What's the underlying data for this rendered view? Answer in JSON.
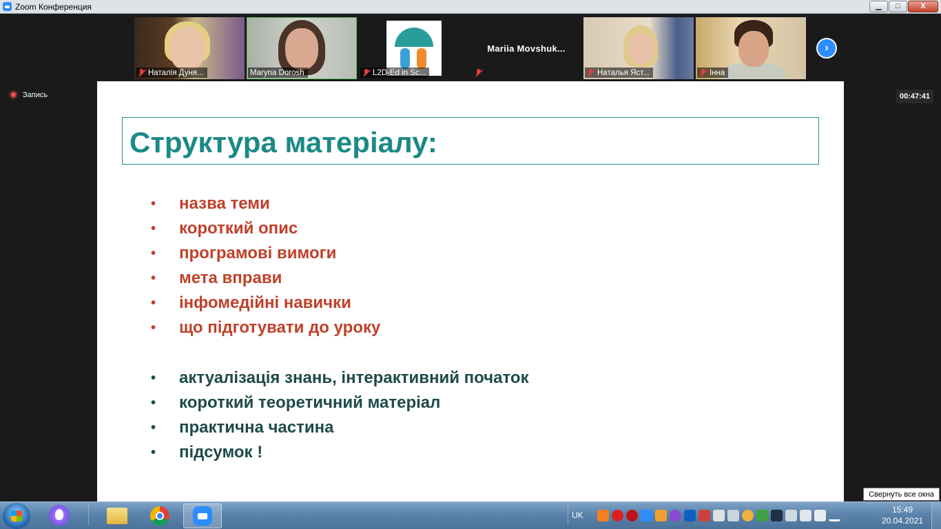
{
  "window": {
    "title": "Zoom Конференция",
    "minimize": "▁",
    "maximize": "□",
    "close": "X"
  },
  "participants": [
    {
      "name": "Наталія Дуня..."
    },
    {
      "name": "Maryna Dorosh"
    },
    {
      "name": "L2D-Ed in Sc..."
    },
    {
      "name": "Mariia  Movshuk..."
    },
    {
      "name": "Наталья Яст..."
    },
    {
      "name": "Інна"
    }
  ],
  "recording": {
    "label": "Запись"
  },
  "timer": "00:47:41",
  "slide": {
    "title": "Структура матеріалу:",
    "items_red": [
      "назва теми",
      "короткий опис",
      "програмові вимоги",
      "мета вправи",
      "інфомедійні навички",
      "що підготувати до уроку"
    ],
    "items_dark": [
      "актуалізація знань, інтерактивний початок",
      "короткий теоретичний матеріал",
      "практична частина",
      "підсумок !"
    ],
    "bullet": "•",
    "colors": {
      "title": "#1a8a86",
      "red_items": "#c0402a",
      "dark_items": "#1e4a4a"
    }
  },
  "tooltip": "Свернуть все окна",
  "taskbar": {
    "language": "UK",
    "time": "15:49",
    "date": "20.04.2021"
  }
}
